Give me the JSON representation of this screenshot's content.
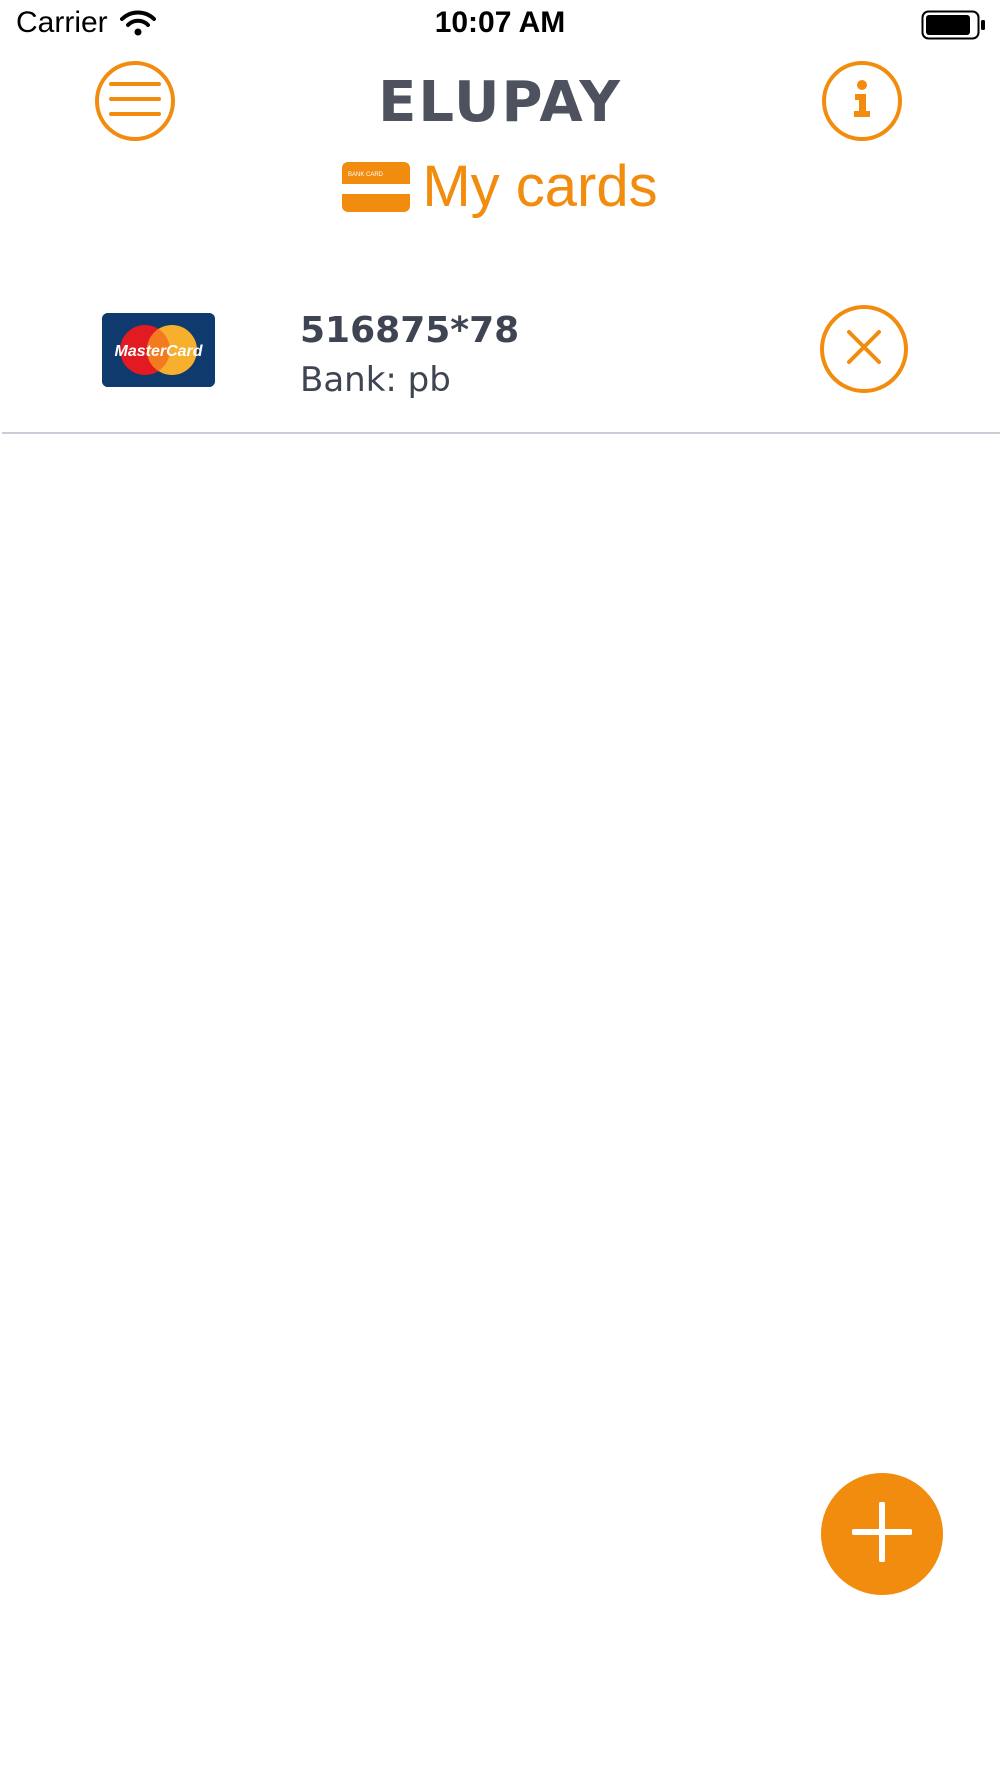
{
  "status_bar": {
    "carrier": "Carrier",
    "time": "10:07 AM"
  },
  "header": {
    "brand": "ELUPAY",
    "title": "My cards",
    "title_icon_text": "BANK CARD"
  },
  "cards": [
    {
      "number": "516875*78",
      "bank": "Bank: pb",
      "brand_label": "MasterCard"
    }
  ],
  "icons": {
    "menu": "hamburger-menu-icon",
    "info": "info-icon",
    "delete": "close-icon",
    "add": "plus-icon",
    "wifi": "wifi-icon",
    "battery": "battery-icon",
    "card": "bank-card-icon"
  },
  "colors": {
    "accent": "#F28C0F",
    "text_dark": "#3E4451",
    "brand_text": "#4D525E",
    "divider": "#C9CDD6"
  }
}
